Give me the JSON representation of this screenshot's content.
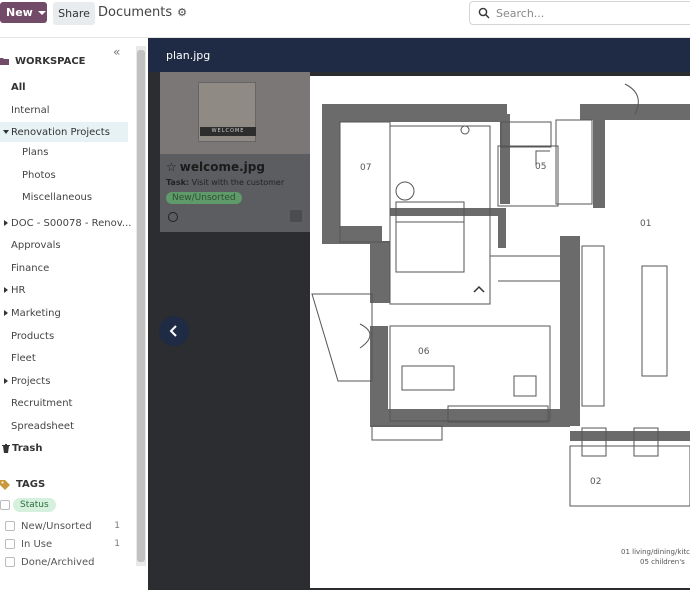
{
  "toolbar": {
    "new_label": "New",
    "share_label": "Share",
    "title": "Documents",
    "search_placeholder": "Search..."
  },
  "sidebar": {
    "workspace_heading": "WORKSPACE",
    "items": [
      {
        "label": "All"
      },
      {
        "label": "Internal"
      },
      {
        "label": "Renovation Projects"
      },
      {
        "label": "Plans"
      },
      {
        "label": "Photos"
      },
      {
        "label": "Miscellaneous"
      },
      {
        "label": "DOC - S00078 - Renov..."
      },
      {
        "label": "Approvals"
      },
      {
        "label": "Finance"
      },
      {
        "label": "HR"
      },
      {
        "label": "Marketing"
      },
      {
        "label": "Products"
      },
      {
        "label": "Fleet"
      },
      {
        "label": "Projects"
      },
      {
        "label": "Recruitment"
      },
      {
        "label": "Spreadsheet"
      },
      {
        "label": "Trash"
      }
    ],
    "tags_heading": "TAGS",
    "status_pill": "Status",
    "tags": [
      {
        "label": "New/Unsorted",
        "count": "1"
      },
      {
        "label": "In Use",
        "count": "1"
      },
      {
        "label": "Done/Archived",
        "count": ""
      }
    ]
  },
  "viewer": {
    "filename": "plan.jpg",
    "card": {
      "title": "welcome.jpg",
      "task_label": "Task:",
      "task_value": "Visit with the customer",
      "status": "New/Unsorted",
      "image_sign": "WELCOME"
    },
    "plan": {
      "rooms": [
        "07",
        "05",
        "01",
        "06",
        "02"
      ],
      "legend": [
        "01 living/dining/kitc",
        "05 children's"
      ]
    }
  },
  "colors": {
    "brand": "#714b67",
    "viewer_bg": "#2b2d30",
    "viewer_head": "#1f2a44",
    "active_row": "#e6f2f3",
    "status_green": "#d5f0dc"
  }
}
